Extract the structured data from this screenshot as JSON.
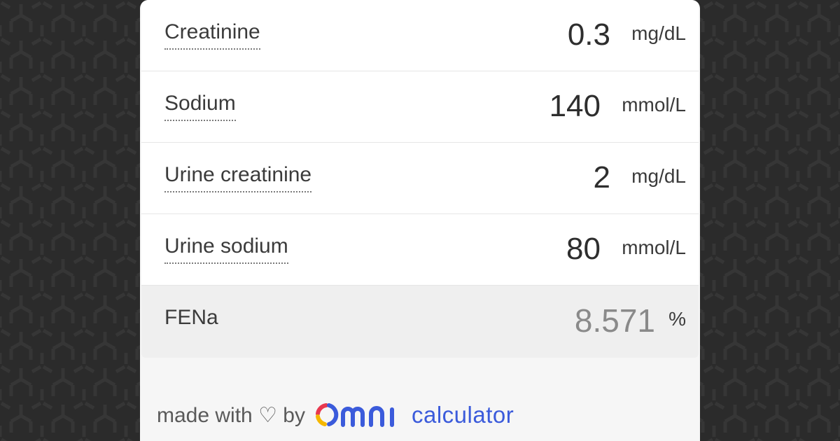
{
  "fields": [
    {
      "label": "Creatinine",
      "value": "0.3",
      "unit": "mg/dL"
    },
    {
      "label": "Sodium",
      "value": "140",
      "unit": "mmol/L"
    },
    {
      "label": "Urine creatinine",
      "value": "2",
      "unit": "mg/dL"
    },
    {
      "label": "Urine sodium",
      "value": "80",
      "unit": "mmol/L"
    }
  ],
  "result": {
    "label": "FENa",
    "value": "8.571",
    "unit": "%"
  },
  "footer": {
    "made_with": "made with ♡ by",
    "brand_word": "calculator"
  },
  "colors": {
    "background": "#2b2b2b",
    "brand_blue": "#3b5bdb",
    "logo_red": "#e8384f",
    "logo_yellow": "#f5b700",
    "logo_blue": "#3b5bdb"
  }
}
